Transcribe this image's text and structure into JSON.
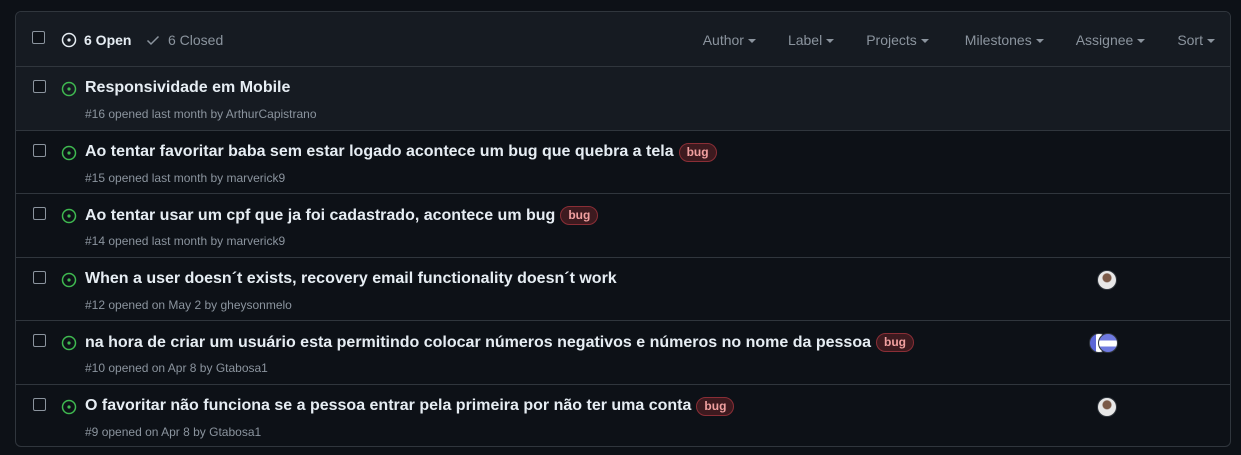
{
  "header": {
    "open_count_label": "6 Open",
    "closed_count_label": "6 Closed",
    "filters": [
      {
        "label": "Author"
      },
      {
        "label": "Label"
      },
      {
        "label": "Projects"
      },
      {
        "label": "Milestones"
      },
      {
        "label": "Assignee"
      },
      {
        "label": "Sort"
      }
    ]
  },
  "issues": [
    {
      "title": "Responsividade em Mobile",
      "number": "#16",
      "opened_text": "opened last month by",
      "author": "ArthurCapistrano",
      "labels": [],
      "assignee_avatar": null
    },
    {
      "title": "Ao tentar favoritar baba sem estar logado acontece um bug que quebra a tela",
      "number": "#15",
      "opened_text": "opened last month by",
      "author": "marverick9",
      "labels": [
        "bug"
      ],
      "assignee_avatar": null
    },
    {
      "title": "Ao tentar usar um cpf que ja foi cadastrado, acontece um bug",
      "number": "#14",
      "opened_text": "opened last month by",
      "author": "marverick9",
      "labels": [
        "bug"
      ],
      "assignee_avatar": null
    },
    {
      "title": "When a user doesn´t exists, recovery email functionality doesn´t work",
      "number": "#12",
      "opened_text": "opened on May 2 by",
      "author": "gheysonmelo",
      "labels": [],
      "assignee_avatar": "person"
    },
    {
      "title": "na hora de criar um usuário esta permitindo colocar números negativos e números no nome da pessoa",
      "number": "#10",
      "opened_text": "opened on Apr 8 by",
      "author": "Gtabosa1",
      "labels": [
        "bug"
      ],
      "assignee_avatar": "pair"
    },
    {
      "title": "O favoritar não funciona se a pessoa entrar pela primeira por não ter uma conta",
      "number": "#9",
      "opened_text": "opened on Apr 8 by",
      "author": "Gtabosa1",
      "labels": [
        "bug"
      ],
      "assignee_avatar": "person"
    }
  ],
  "colors": {
    "background": "#0d1117",
    "header_bg": "#161b22",
    "border": "#30363d",
    "open_icon": "#3fb950",
    "muted_text": "#8b949e",
    "bug_label_text": "#f1a0a0",
    "bug_label_border": "#8a2e36"
  }
}
